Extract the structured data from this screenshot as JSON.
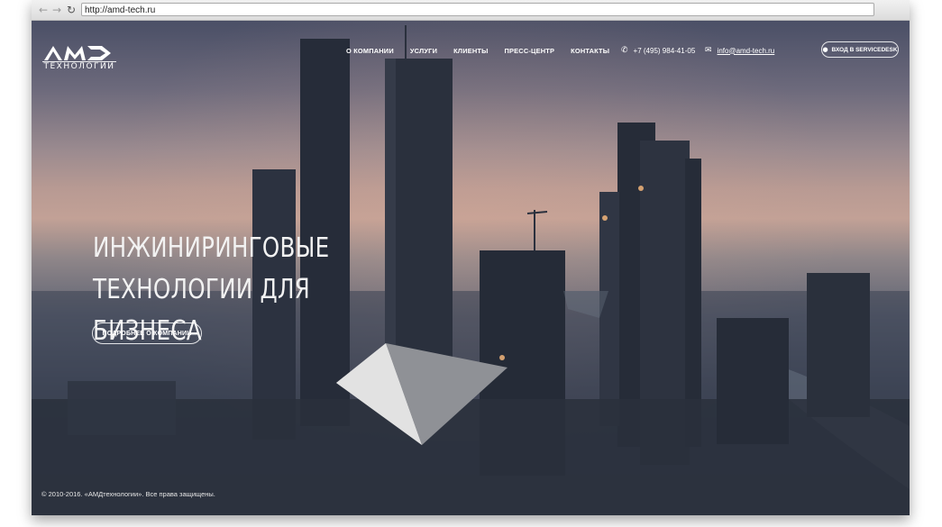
{
  "browser": {
    "url": "http://amd-tech.ru",
    "back_icon": "back-arrow-icon",
    "forward_icon": "forward-arrow-icon",
    "reload_icon": "reload-icon"
  },
  "header": {
    "logo_mark": "AMD",
    "logo_subtitle": "ТЕХНОЛОГИИ",
    "nav": [
      {
        "label": "О КОМПАНИИ"
      },
      {
        "label": "УСЛУГИ"
      },
      {
        "label": "КЛИЕНТЫ"
      },
      {
        "label": "ПРЕСС-ЦЕНТР"
      },
      {
        "label": "КОНТАКТЫ"
      }
    ],
    "phone": "+7 (495) 984-41-05",
    "email": "info@amd-tech.ru",
    "servicedesk_label": "ВХОД В SERVICEDESK"
  },
  "hero": {
    "title_line1": "ИНЖИНИРИНГОВЫЕ ТЕХНОЛОГИИ ДЛЯ",
    "title_line2": "БИЗНЕСА",
    "cta_label": "ПОДРОБНЕЕ О КОМПАНИИ"
  },
  "footer": {
    "copyright": "© 2010-2016. «АМДтехнологии». Все права защищены."
  },
  "colors": {
    "text": "#ffffff",
    "sky_top": "#4a4f66",
    "sky_glow": "#c2a196",
    "ground": "#2f3646"
  }
}
